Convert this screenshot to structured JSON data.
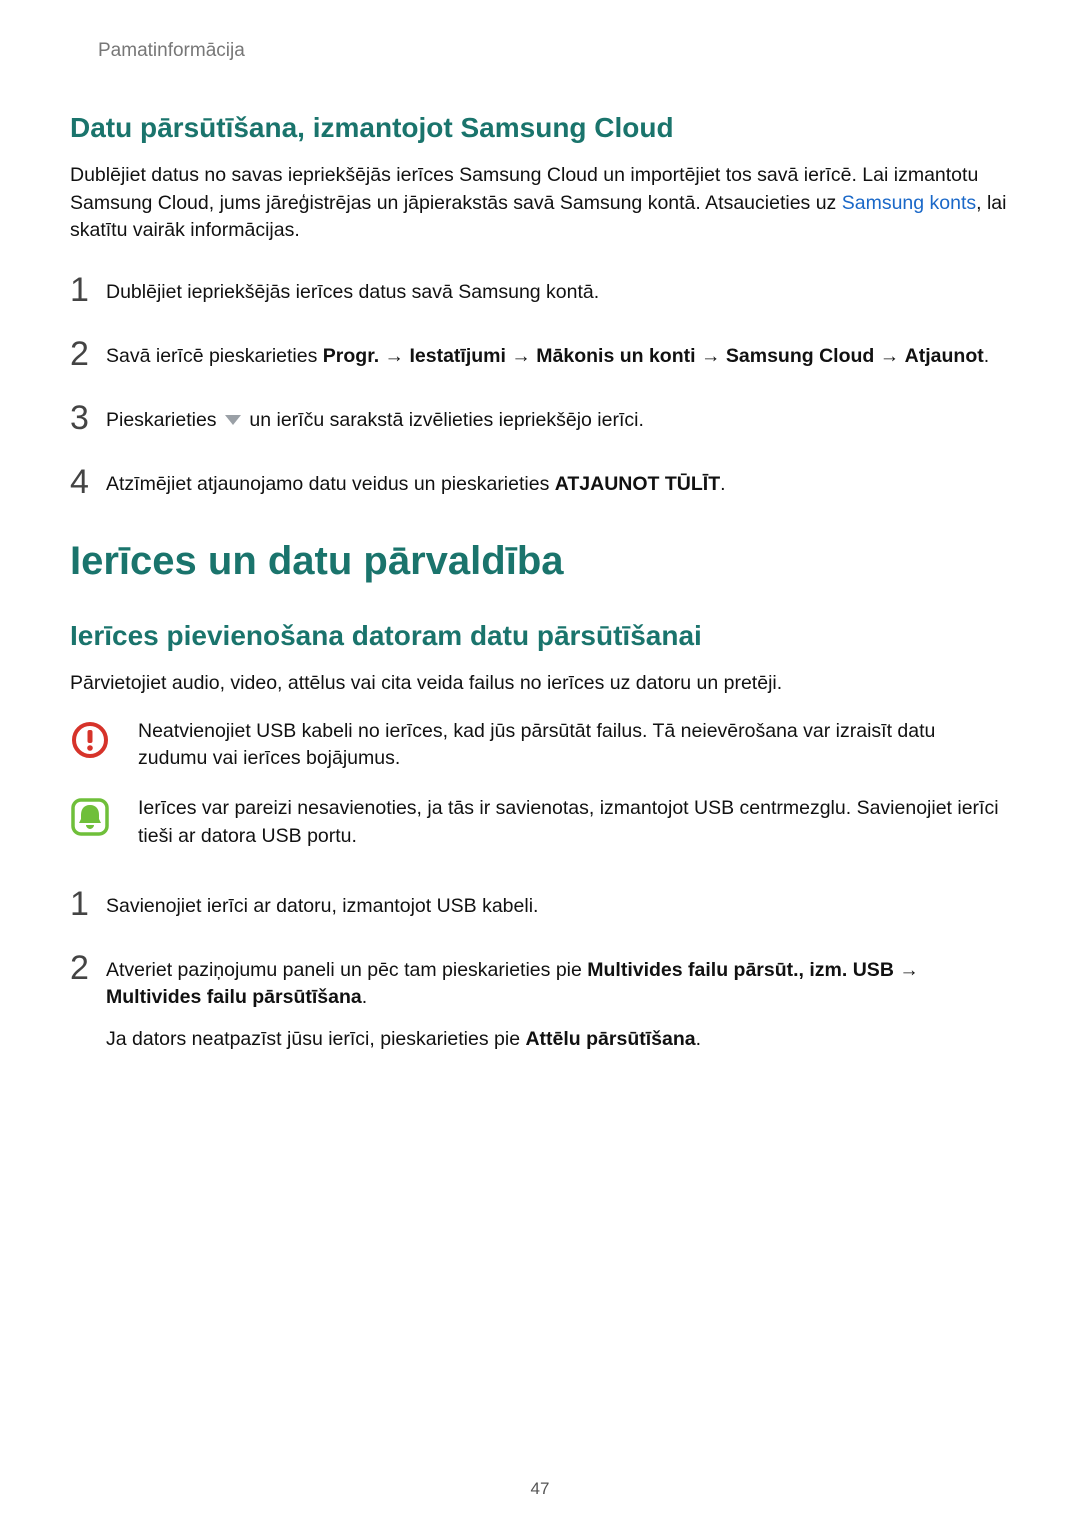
{
  "header": "Pamatinformācija",
  "section1": {
    "title": "Datu pārsūtīšana, izmantojot Samsung Cloud",
    "intro_a": "Dublējiet datus no savas iepriekšējās ierīces Samsung Cloud un importējiet tos savā ierīcē. Lai izmantotu Samsung Cloud, jums jāreģistrējas un jāpierakstās savā Samsung kontā. Atsaucieties uz ",
    "intro_link": "Samsung konts",
    "intro_b": ", lai skatītu vairāk informācijas.",
    "step1_num": "1",
    "step1": "Dublējiet iepriekšējās ierīces datus savā Samsung kontā.",
    "step2_num": "2",
    "step2_a": "Savā ierīcē pieskarieties ",
    "step2_b": "Progr.",
    "step2_arrow": " → ",
    "step2_c": "Iestatījumi",
    "step2_d": "Mākonis un konti",
    "step2_e": "Samsung Cloud",
    "step2_f": "Atjaunot",
    "step2_period": ".",
    "step3_num": "3",
    "step3_a": "Pieskarieties ",
    "step3_b": " un ierīču sarakstā izvēlieties iepriekšējo ierīci.",
    "step4_num": "4",
    "step4_a": "Atzīmējiet atjaunojamo datu veidus un pieskarieties ",
    "step4_b": "ATJAUNOT TŪLĪT",
    "step4_c": "."
  },
  "section2": {
    "title": "Ierīces un datu pārvaldība",
    "subtitle": "Ierīces pievienošana datoram datu pārsūtīšanai",
    "intro": "Pārvietojiet audio, video, attēlus vai cita veida failus no ierīces uz datoru un pretēji.",
    "warning": "Neatvienojiet USB kabeli no ierīces, kad jūs pārsūtāt failus. Tā neievērošana var izraisīt datu zudumu vai ierīces bojājumus.",
    "info": "Ierīces var pareizi nesavienoties, ja tās ir savienotas, izmantojot USB centrmezglu. Savienojiet ierīci tieši ar datora USB portu.",
    "step1_num": "1",
    "step1": "Savienojiet ierīci ar datoru, izmantojot USB kabeli.",
    "step2_num": "2",
    "step2_a": "Atveriet paziņojumu paneli un pēc tam pieskarieties pie ",
    "step2_b": "Multivides failu pārsūt., izm. USB",
    "step2_arrow": " → ",
    "step2_c": "Multivides failu pārsūtīšana",
    "step2_d": ".",
    "step2_sub_a": "Ja dators neatpazīst jūsu ierīci, pieskarieties pie ",
    "step2_sub_b": "Attēlu pārsūtīšana",
    "step2_sub_c": "."
  },
  "page_number": "47"
}
